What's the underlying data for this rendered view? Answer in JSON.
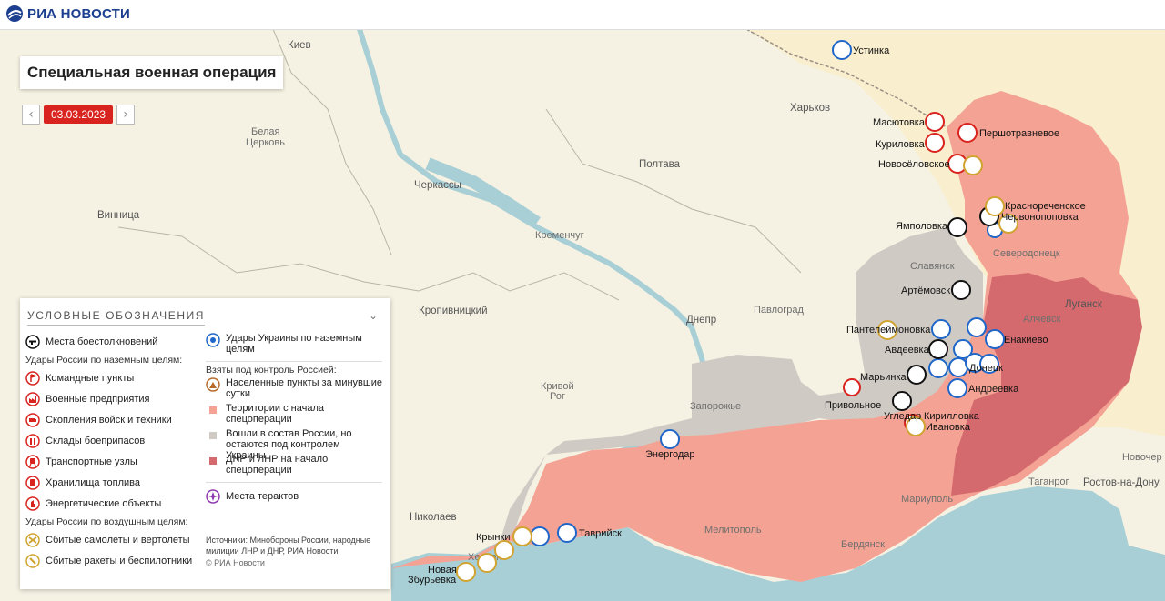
{
  "brand": {
    "name": "РИА НОВОСТИ"
  },
  "title": "Специальная военная операция",
  "date_nav": {
    "date": "03.03.2023",
    "prev": "‹",
    "next": "›"
  },
  "colors": {
    "taken_since_start": "#f4a294",
    "dnr_lnr": "#d46a6e",
    "disputed": "#cfcac4",
    "water": "#a9cfd6",
    "land": "#f5f2e3",
    "russia": "#f9efce",
    "date_bg": "#d9231e",
    "ukr_strike": "#1f66c9",
    "rus_strike": "#d9231e"
  },
  "cities": {
    "kiev": "Киев",
    "belaya_tserkov_1": "Белая",
    "belaya_tserkov_2": "Церковь",
    "vinnitsa": "Винница",
    "cherkassy": "Черкассы",
    "poltava": "Полтава",
    "kharkov": "Харьков",
    "kremenchug": "Кременчуг",
    "kropivnitsky": "Кропивницкий",
    "dnepr": "Днепр",
    "pavlograd": "Павлоград",
    "krivoy_rog_1": "Кривой",
    "krivoy_rog_2": "Рог",
    "zaporozhye": "Запорожье",
    "nikolaev": "Николаев",
    "kherson": "Херсон",
    "melitopol": "Мелитополь",
    "mariupol": "Мариуполь",
    "berdyansk": "Бердянск",
    "taganrog": "Таганрог",
    "rostov": "Ростов-на-Дону",
    "novocherkassk": "Новочер",
    "lugansk": "Луганск",
    "alchevsk": "Алчевск",
    "severodonetsk": "Северодонецк",
    "slavyansk": "Славянск"
  },
  "places": {
    "ustinka": "Устинка",
    "masyutovka": "Масютовка",
    "kurilovka": "Куриловка",
    "novoselovskoe": "Новосёловское",
    "pershotravnevoe": "Першотравневое",
    "krasnorechenskoe": "Краснореченское",
    "chervonopopovka": "Червонопоповка",
    "yampolovka": "Ямполовка",
    "artemovsk": "Артёмовск",
    "panteleimonovka": "Пантелеймоновка",
    "enakievo": "Енакиево",
    "avdeevka": "Авдеевка",
    "donetsk": "Донецк",
    "marinka": "Марьинка",
    "andreevka": "Андреевка",
    "privolnoe": "Привольное",
    "ugledar": "Угледар",
    "kirillovka": "Кирилловка",
    "ivanovka": "Ивановка",
    "energodar": "Энергодар",
    "krynki": "Крынки",
    "tavriysk": "Таврийск",
    "novaya_1": "Новая",
    "novaya_2": "Збурьевка"
  },
  "legend": {
    "heading": "УСЛОВНЫЕ ОБОЗНАЧЕНИЯ",
    "battles": "Места боестолкновений",
    "ground_heading": "Удары России по наземным целям:",
    "command": "Командные пункты",
    "military": "Военные предприятия",
    "troops": "Скопления войск и техники",
    "ammo": "Склады боеприпасов",
    "transport": "Транспортные узлы",
    "fuel": "Хранилища топлива",
    "energy": "Энергетические объекты",
    "air_heading": "Удары России по воздушным целям:",
    "planes": "Сбитые самолеты и вертолеты",
    "missiles": "Сбитые ракеты и беспилотники",
    "ukr_strikes_1": "Удары Украины по наземным",
    "ukr_strikes_2": "целям",
    "control_heading": "Взяты под контроль Россией:",
    "settlements_1": "Населенные пункты за минувшие",
    "settlements_2": "сутки",
    "territories_1": "Территории с начала",
    "territories_2": "спецоперации",
    "joined_1": "Вошли в состав России, но",
    "joined_2": "остаются под контролем Украины",
    "dnr_lnr_1": "ДНР и ЛНР на начало",
    "dnr_lnr_2": "спецоперации",
    "terror": "Места терактов",
    "sources_1": "Источники: Минобороны России, народные",
    "sources_2": "милиции ЛНР и ДНР, РИА Новости",
    "copyright": "© РИА Новости"
  }
}
